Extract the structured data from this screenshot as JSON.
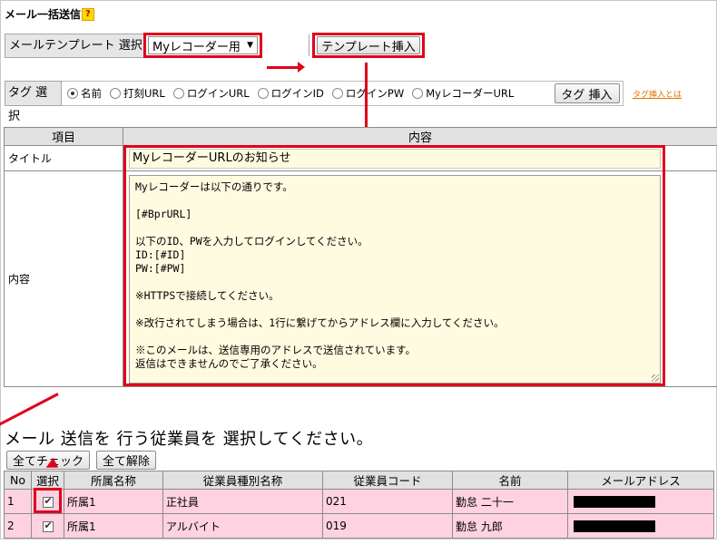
{
  "page": {
    "title": "メール一括送信",
    "help_label": "?"
  },
  "template": {
    "label": "メールテンプレート 選択",
    "selected": "Myレコーダー用",
    "insert_button": "テンプレート挿入"
  },
  "tags": {
    "label": "タグ 選択",
    "options": [
      "名前",
      "打刻URL",
      "ログインURL",
      "ログインID",
      "ログインPW",
      "MyレコーダーURL"
    ],
    "selected": "名前",
    "insert_button": "タグ 挿入",
    "help_link": "タグ挿入とは"
  },
  "form_table": {
    "col_item": "項目",
    "col_content": "内容",
    "title_label": "タイトル",
    "title_value": "MyレコーダーURLのお知らせ",
    "body_label": "内容",
    "body_value": "Myレコーダーは以下の通りです。\n\n[#BprURL]\n\n以下のID、PWを入力してログインしてください。\nID:[#ID]\nPW:[#PW]\n\n※HTTPSで接続してください。\n\n※改行されてしまう場合は、1行に繋げてからアドレス欄に入力してください。\n\n※このメールは、送信専用のアドレスで送信されています。\n返信はできませんのでご了承ください。"
  },
  "employees_section": {
    "heading": "メール 送信を 行う従業員を 選択してください。",
    "check_all": "全てチェック",
    "uncheck_all": "全て解除",
    "columns": [
      "No",
      "選択",
      "所属名称",
      "従業員種別名称",
      "従業員コード",
      "名前",
      "メールアドレス"
    ],
    "rows": [
      {
        "no": "1",
        "checked": true,
        "dept": "所属1",
        "type": "正社員",
        "code": "021",
        "name": "勤怠 二十一"
      },
      {
        "no": "2",
        "checked": true,
        "dept": "所属1",
        "type": "アルバイト",
        "code": "019",
        "name": "勤怠 九郎"
      }
    ]
  },
  "colors": {
    "annotation_red": "#e0001b",
    "row_pink": "#ffd2e2",
    "input_bg": "#fffbe0",
    "help_yellow": "#ffd900",
    "link_orange": "#e07800"
  }
}
